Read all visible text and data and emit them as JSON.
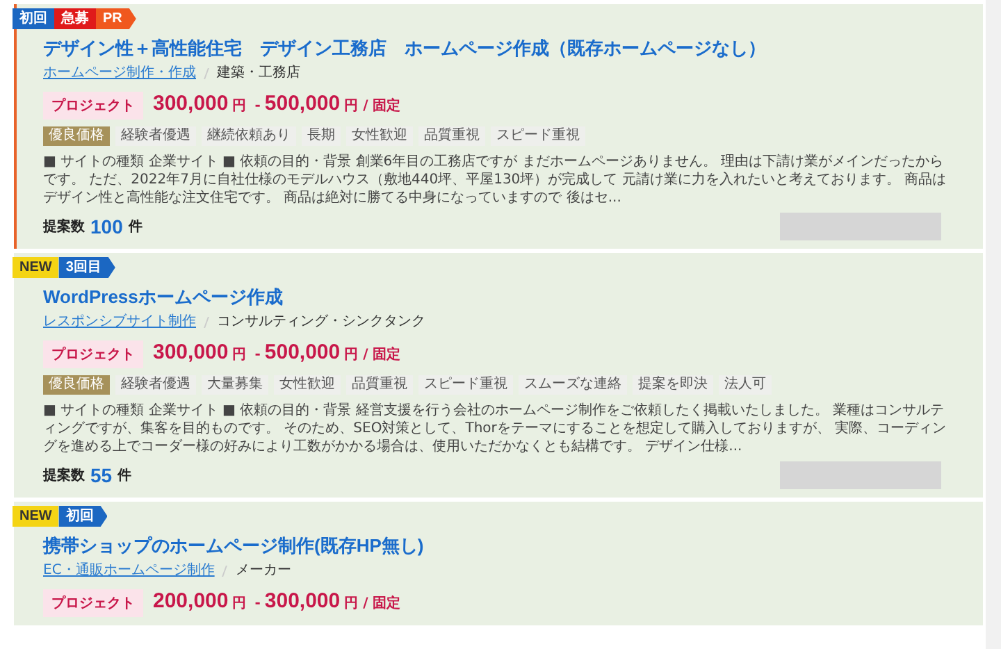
{
  "jobs": [
    {
      "highlighted": true,
      "badges": [
        {
          "kind": "first",
          "label": "初回"
        },
        {
          "kind": "urgent",
          "label": "急募"
        },
        {
          "kind": "pr",
          "label": "PR"
        }
      ],
      "title": "デザイン性＋高性能住宅　デザイン工務店　ホームページ作成（既存ホームページなし）",
      "category": "ホームページ制作・作成",
      "industry": "建築・工務店",
      "type": "プロジェクト",
      "price_min": "300,000",
      "price_min_unit": "円",
      "separator": "-",
      "price_max": "500,000",
      "price_max_unit": "円 / 固定",
      "tags": [
        {
          "kind": "premium",
          "label": "優良価格"
        },
        {
          "kind": "normal",
          "label": "経験者優遇"
        },
        {
          "kind": "normal",
          "label": "継続依頼あり"
        },
        {
          "kind": "normal",
          "label": "長期"
        },
        {
          "kind": "normal",
          "label": "女性歓迎"
        },
        {
          "kind": "normal",
          "label": "品質重視"
        },
        {
          "kind": "normal",
          "label": "スピード重視"
        }
      ],
      "description": "■ サイトの種類 企業サイト ■ 依頼の目的・背景 創業6年目の工務店ですが まだホームページありません。 理由は下請け業がメインだったからです。 ただ、2022年7月に自社仕様のモデルハウス（敷地440坪、平屋130坪）が完成して 元請け業に力を入れたいと考えております。 商品はデザイン性と高性能な注文住宅です。 商品は絶対に勝てる中身になっていますので 後はセ...",
      "proposals_label": "提案数",
      "proposals": "100",
      "proposals_unit": "件"
    },
    {
      "highlighted": false,
      "badges": [
        {
          "kind": "new",
          "label": "NEW"
        },
        {
          "kind": "count",
          "label": "3回目"
        }
      ],
      "title": "WordPressホームページ作成",
      "category": "レスポンシブサイト制作",
      "industry": "コンサルティング・シンクタンク",
      "type": "プロジェクト",
      "price_min": "300,000",
      "price_min_unit": "円",
      "separator": "-",
      "price_max": "500,000",
      "price_max_unit": "円 / 固定",
      "tags": [
        {
          "kind": "premium",
          "label": "優良価格"
        },
        {
          "kind": "normal",
          "label": "経験者優遇"
        },
        {
          "kind": "normal",
          "label": "大量募集"
        },
        {
          "kind": "normal",
          "label": "女性歓迎"
        },
        {
          "kind": "normal",
          "label": "品質重視"
        },
        {
          "kind": "normal",
          "label": "スピード重視"
        },
        {
          "kind": "normal",
          "label": "スムーズな連絡"
        },
        {
          "kind": "normal",
          "label": "提案を即決"
        },
        {
          "kind": "normal",
          "label": "法人可"
        }
      ],
      "description": "■ サイトの種類 企業サイト ■ 依頼の目的・背景 経営支援を行う会社のホームページ制作をご依頼したく掲載いたしました。 業種はコンサルティングですが、集客を目的ものです。 そのため、SEO対策として、Thorをテーマにすることを想定して購入しておりますが、 実際、コーディングを進める上でコーダー様の好みにより工数がかかる場合は、使用いただかなくとも結構です。 デザイン仕様...",
      "proposals_label": "提案数",
      "proposals": "55",
      "proposals_unit": "件"
    },
    {
      "highlighted": false,
      "badges": [
        {
          "kind": "new",
          "label": "NEW"
        },
        {
          "kind": "first",
          "label": "初回"
        }
      ],
      "title": "携帯ショップのホームページ制作(既存HP無し)",
      "category": "EC・通販ホームページ制作",
      "industry": "メーカー",
      "type": "プロジェクト",
      "price_min": "200,000",
      "price_min_unit": "円",
      "separator": "-",
      "price_max": "300,000",
      "price_max_unit": "円 / 固定"
    }
  ]
}
